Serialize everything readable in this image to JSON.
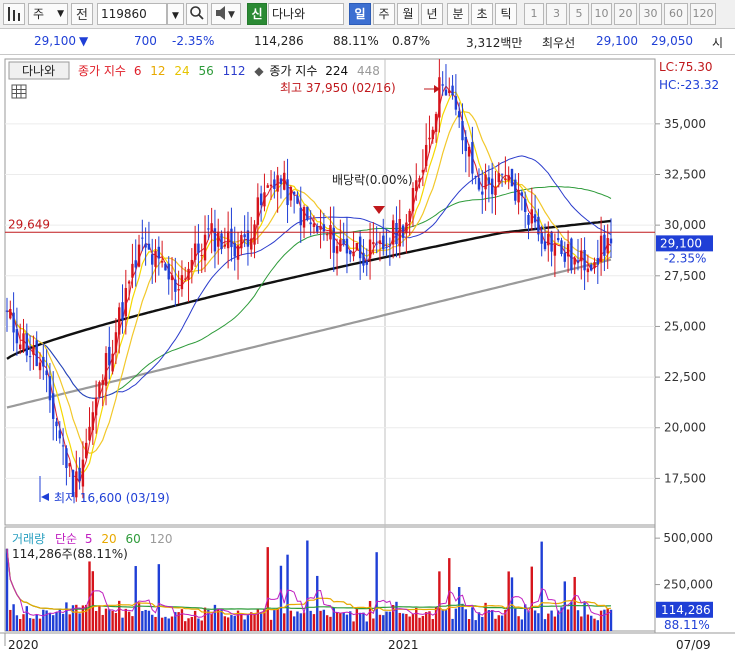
{
  "toolbar": {
    "market_label": "주",
    "stock_code": "119860",
    "new_badge": "신",
    "stock_name": "다나와",
    "period_buttons": [
      "일",
      "주",
      "월",
      "년",
      "분",
      "초",
      "틱"
    ],
    "active_period": "일",
    "interval_buttons": [
      "1",
      "3",
      "5",
      "10",
      "20",
      "30",
      "60",
      "120"
    ]
  },
  "quote": {
    "price": "29,100",
    "change_symbol": "▼",
    "change": "700",
    "change_pct": "-2.35%",
    "volume": "114,286",
    "volume_ratio": "88.11%",
    "turnover_pct": "0.87%",
    "amount": "3,312백만",
    "priority_label": "최우선",
    "ask": "29,100",
    "bid": "29,050",
    "tail": "시"
  },
  "colors": {
    "up": "#d6141c",
    "down": "#1f3fd6",
    "ma6": "#e0202a",
    "ma12": "#f2c82b",
    "ma24": "#f5d800",
    "ma56": "#2e9b3a",
    "ma112": "#2b3ccc",
    "ma224": "#111111",
    "ma448": "#9a9a9a"
  },
  "price_panel": {
    "name_tag": "다나와",
    "legend_label": "종가 지수",
    "legend_values": [
      "6",
      "12",
      "24",
      "56",
      "112"
    ],
    "legend_label2": "종가 지수",
    "legend_value224": "224",
    "legend_value448": "448",
    "lc": "LC:75.30",
    "hc": "HC:-23.32",
    "high_note": "최고 37,950 (02/16)",
    "low_note": "최저 16,600 (03/19)",
    "dividend_note": "배당락(0.00%)",
    "ref_line_value": "29,649",
    "ref_line_price": 29649,
    "current_price": 29100,
    "current_price_label": "29,100",
    "current_change_label": "-2.35%",
    "y_ticks": [
      "17,500",
      "20,000",
      "22,500",
      "25,000",
      "27,500",
      "30,000",
      "32,500",
      "35,000"
    ],
    "y_tick_values": [
      17500,
      20000,
      22500,
      25000,
      27500,
      30000,
      32500,
      35000
    ],
    "y_min": 15200,
    "y_max": 38200
  },
  "volume_panel": {
    "title": "거래량",
    "ma_label": "단순",
    "ma_values": [
      "5",
      "20",
      "60",
      "120"
    ],
    "current_label": "114,286주(88.11%)",
    "y_ticks": [
      "250,000",
      "500,000"
    ],
    "y_tick_values": [
      250000,
      500000
    ],
    "y_max": 560000,
    "current_volume": 114286,
    "current_volume_label": "114,286",
    "current_ratio_label": "88.11%"
  },
  "x_axis": {
    "labels": [
      "2020",
      "2021"
    ],
    "date_label": "07/09"
  },
  "chart_data": {
    "type": "candlestick",
    "ylim": [
      15200,
      38200
    ],
    "anchors": [
      {
        "date": "2020-01",
        "price": 25500
      },
      {
        "date": "2020-02",
        "price": 23000
      },
      {
        "date": "2020-03",
        "price": 17000
      },
      {
        "date": "2020-04",
        "price": 23500
      },
      {
        "date": "2020-05",
        "price": 29000
      },
      {
        "date": "2020-06",
        "price": 27000
      },
      {
        "date": "2020-07",
        "price": 29500
      },
      {
        "date": "2020-08",
        "price": 29000
      },
      {
        "date": "2020-09",
        "price": 32500
      },
      {
        "date": "2020-10",
        "price": 30000
      },
      {
        "date": "2020-11",
        "price": 29000
      },
      {
        "date": "2020-12",
        "price": 28500
      },
      {
        "date": "2021-01",
        "price": 30500
      },
      {
        "date": "2021-02",
        "price": 37500
      },
      {
        "date": "2021-03",
        "price": 32000
      },
      {
        "date": "2021-04",
        "price": 32000
      },
      {
        "date": "2021-05",
        "price": 29500
      },
      {
        "date": "2021-06",
        "price": 28000
      },
      {
        "date": "2021-07",
        "price": 29100
      }
    ],
    "high": {
      "value": 37950,
      "date": "02/16"
    },
    "low": {
      "value": 16600,
      "date": "03/19"
    }
  }
}
